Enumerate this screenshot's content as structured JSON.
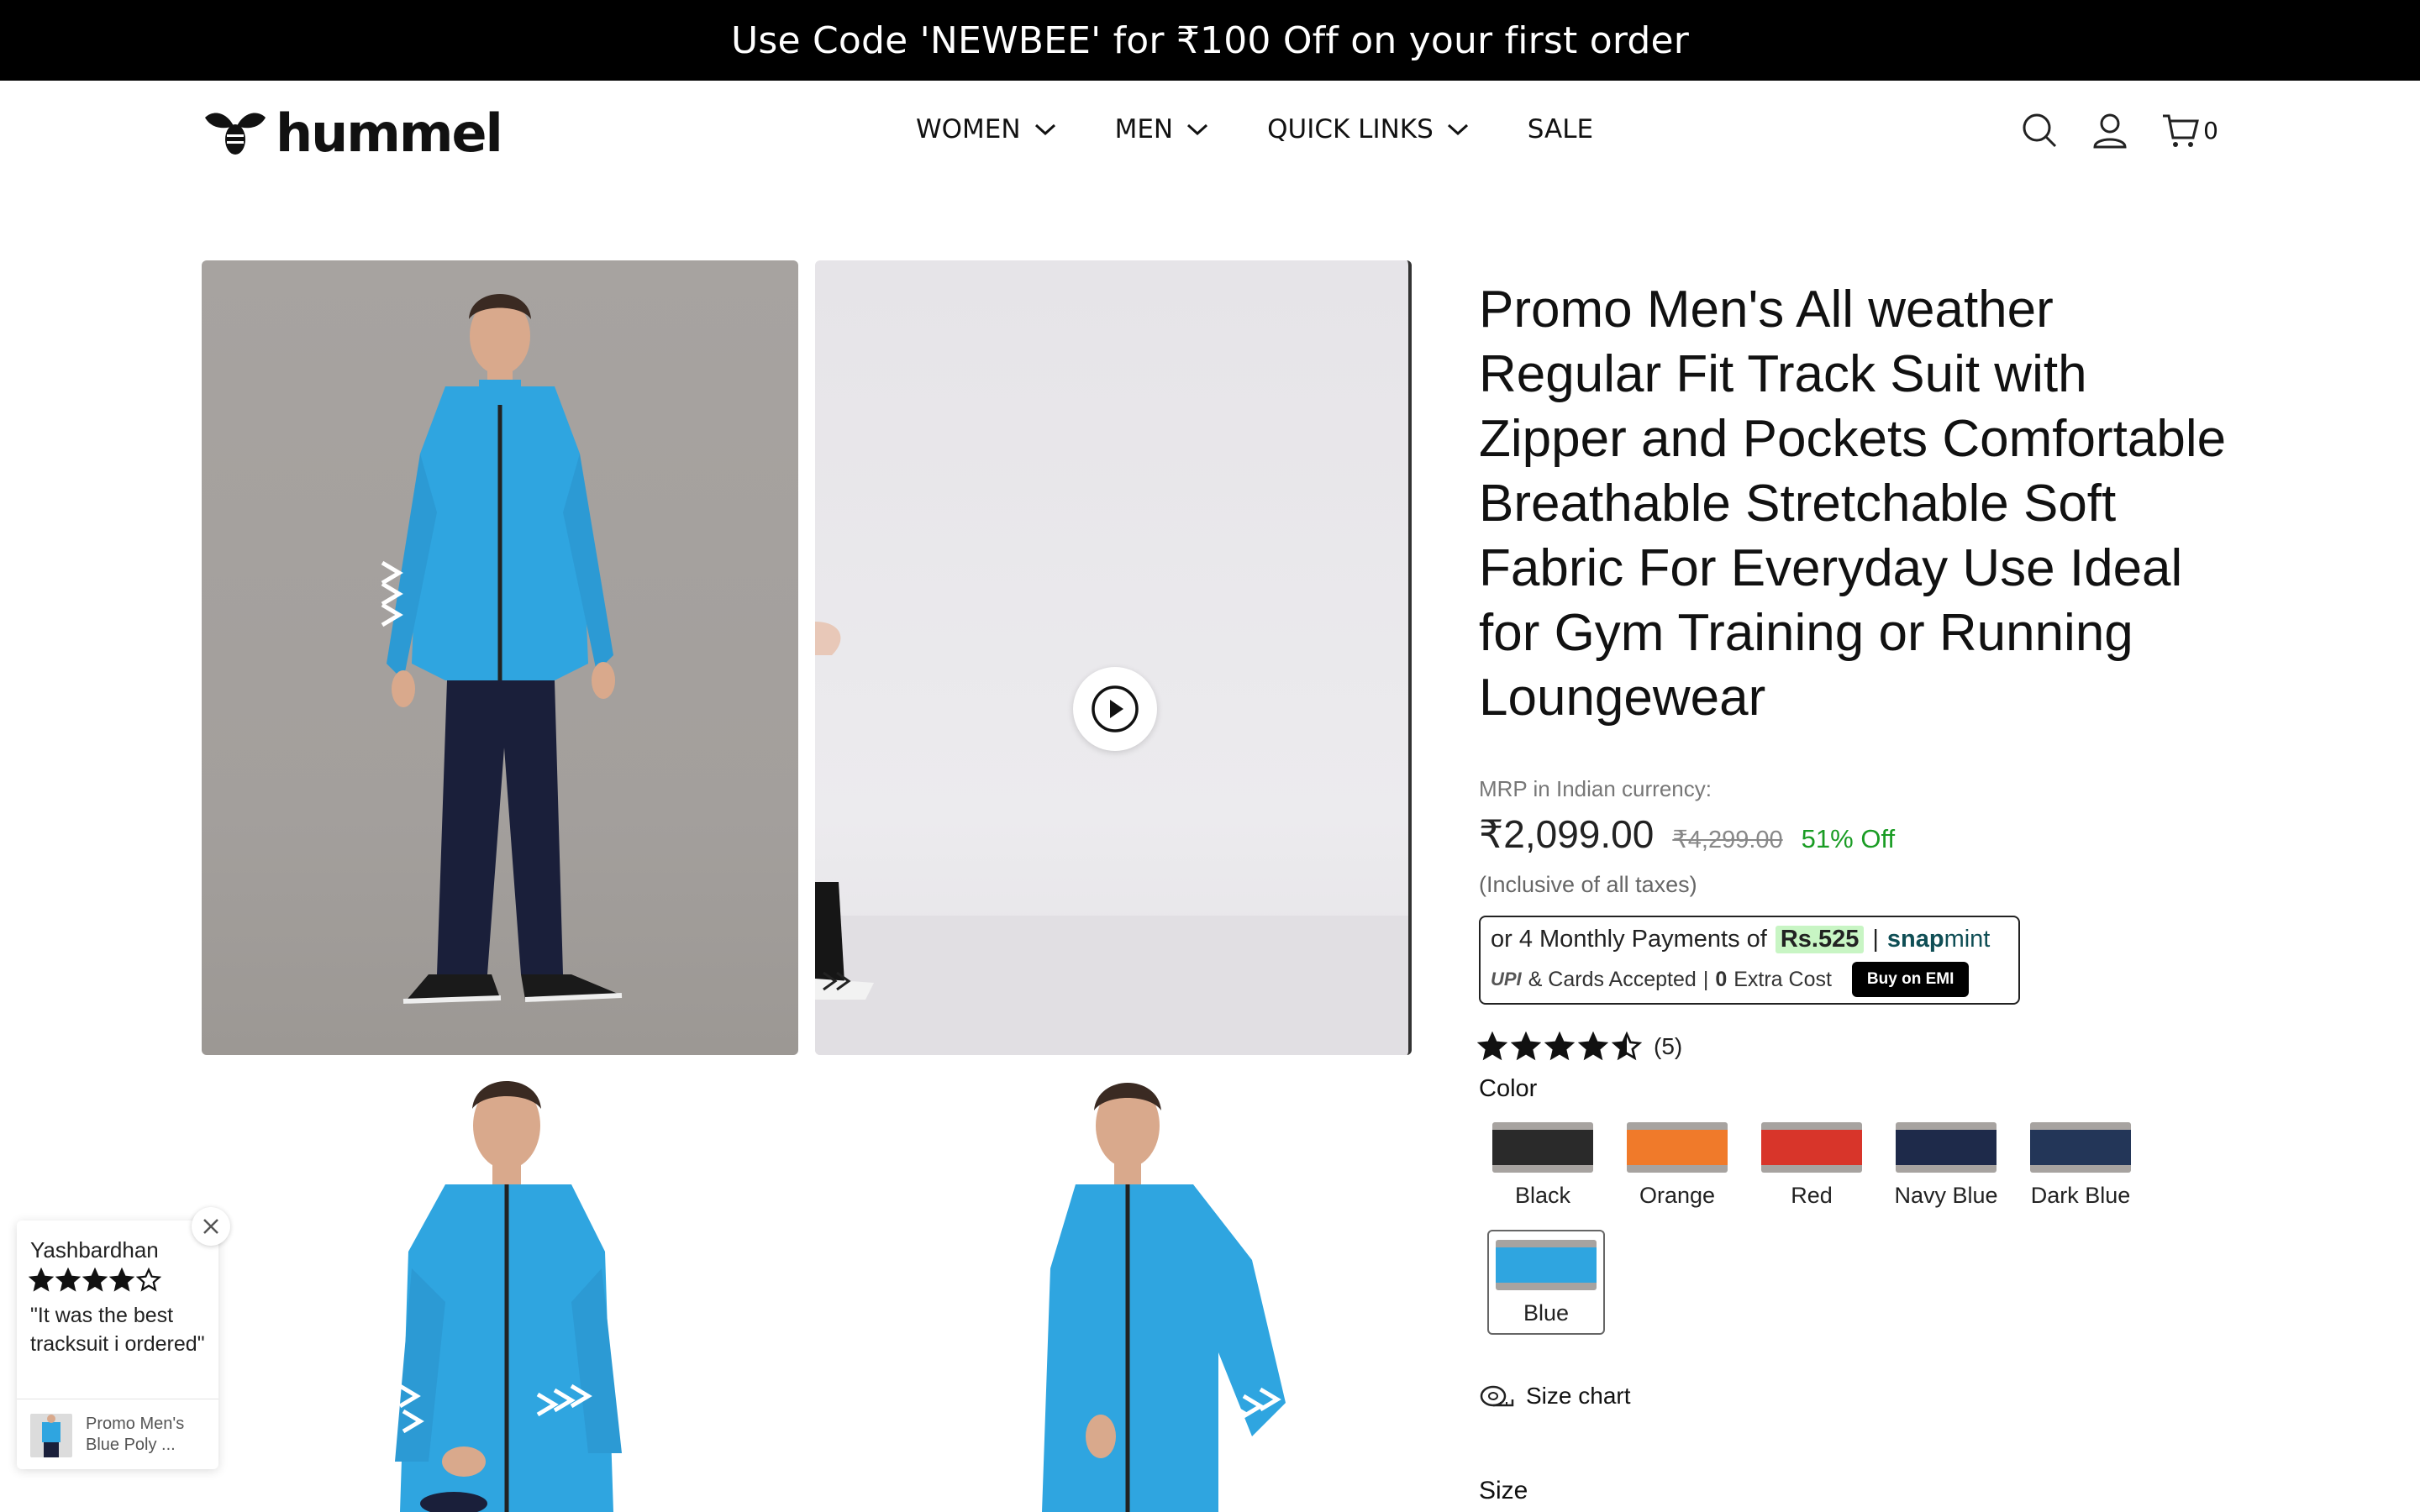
{
  "announcement": "Use Code 'NEWBEE' for ₹100 Off on your first order",
  "brand": {
    "name": "hummel"
  },
  "nav": [
    {
      "label": "WOMEN"
    },
    {
      "label": "MEN"
    },
    {
      "label": "QUICK LINKS"
    },
    {
      "label": "SALE"
    }
  ],
  "header_icons": {
    "search": "search-icon",
    "account": "user-icon",
    "cart": "cart-icon",
    "cart_count": "0"
  },
  "product": {
    "title": "Promo Men's All weather Regular Fit Track Suit with Zipper and Pockets Comfortable Breathable Stretchable Soft Fabric For Everyday Use Ideal for Gym Training or Running Loungewear",
    "mrp_label": "MRP in Indian currency:",
    "price": "₹2,099.00",
    "compare_price": "₹4,299.00",
    "discount": "51% Off",
    "tax_note": "(Inclusive of all taxes)",
    "rating": 4.5,
    "rating_count": "(5)",
    "color_label": "Color",
    "colors": [
      {
        "label": "Black",
        "swatch": "#2a2a2a"
      },
      {
        "label": "Orange",
        "swatch": "#f07a2a"
      },
      {
        "label": "Red",
        "swatch": "#d8352a"
      },
      {
        "label": "Navy Blue",
        "swatch": "#1e2a4a"
      },
      {
        "label": "Dark Blue",
        "swatch": "#233658"
      },
      {
        "label": "Blue",
        "swatch": "#2fa5e0",
        "selected": true
      }
    ],
    "size_chart": "Size chart",
    "size_label": "Size"
  },
  "emi": {
    "prefix": "or 4 Monthly Payments of",
    "amount": "Rs.525",
    "separator": "|",
    "brand_a": "snap",
    "brand_b": "mint",
    "upi": "UPI",
    "cards": "& Cards Accepted",
    "cost_num": "0",
    "cost_text": "Extra Cost",
    "button": "Buy on EMI"
  },
  "review_popup": {
    "name": "Yashbardhan",
    "stars": 4,
    "text": "\"It was the best tracksuit i ordered\"",
    "product": "Promo Men's Blue Poly ..."
  },
  "colors": {
    "jacket": "#2fa5e0",
    "pants": "#1a1f3a",
    "discount_green": "#1a9c24"
  }
}
